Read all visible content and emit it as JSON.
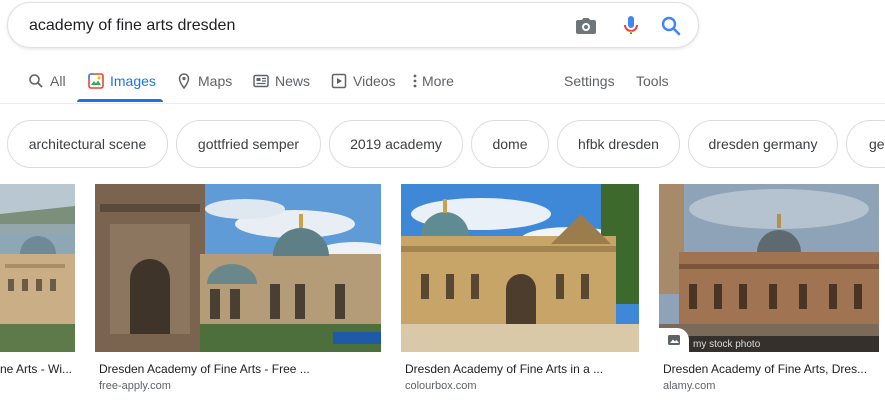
{
  "search": {
    "query": "academy of fine arts dresden",
    "camera_icon": "camera-icon",
    "mic_icon": "microphone-icon",
    "search_icon": "magnifier-icon"
  },
  "tabs": {
    "all": "All",
    "images": "Images",
    "maps": "Maps",
    "news": "News",
    "videos": "Videos",
    "more": "More",
    "settings": "Settings",
    "tools": "Tools"
  },
  "chips": [
    "architectural scene",
    "gottfried semper",
    "2019 academy",
    "dome",
    "hfbk dresden",
    "dresden germany",
    "ge"
  ],
  "results": [
    {
      "title": "ne Arts - Wi...",
      "source": ""
    },
    {
      "title": "Dresden Academy of Fine Arts - Free ...",
      "source": "free-apply.com"
    },
    {
      "title": "Dresden Academy of Fine Arts in a ...",
      "source": "colourbox.com"
    },
    {
      "title": "Dresden Academy of Fine Arts, Dres...",
      "source": "alamy.com",
      "watermark": "my stock photo"
    }
  ],
  "colors": {
    "accent": "#1a73e8",
    "text": "#202124",
    "muted": "#5f6368"
  }
}
